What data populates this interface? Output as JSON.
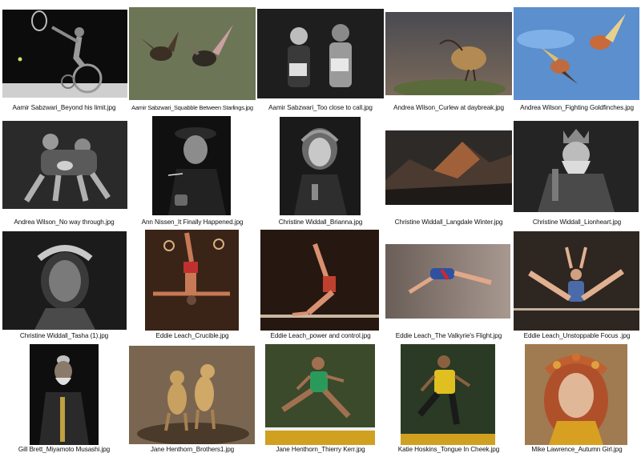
{
  "gallery": {
    "items": [
      {
        "filename": "Aamir Sabzwari_Beyond his limit.jpg",
        "subject": "wheelchair-tennis-icon",
        "bg": "#0c0c0c",
        "fg": "#9a9a9a"
      },
      {
        "filename": "Aamir Sabzwari_Squabble Between Starlings.jpg",
        "subject": "starlings-icon",
        "bg": "#6d7557",
        "fg": "#3a2f22"
      },
      {
        "filename": "Aamir Sabzwari_Too close to call.jpg",
        "subject": "runners-icon",
        "bg": "#1e1e1e",
        "fg": "#c9c9c9"
      },
      {
        "filename": "Andrea Wilson_Curlew at daybreak.jpg",
        "subject": "curlew-icon",
        "bg": "#5d5148",
        "fg": "#b38a52"
      },
      {
        "filename": "Andrea Wilson_Fighting Goldfinches.jpg",
        "subject": "goldfinches-icon",
        "bg": "#5b8fce",
        "fg": "#c86a3a"
      },
      {
        "filename": "Andrea Wilson_No way through.jpg",
        "subject": "rugby-icon",
        "bg": "#2a2a2a",
        "fg": "#a8a8a8"
      },
      {
        "filename": "Ann Nissen_It Finally Happened.jpg",
        "subject": "smoker-portrait-icon",
        "bg": "#101010",
        "fg": "#8c8c8c"
      },
      {
        "filename": "Christine Widdall_Brianna.jpg",
        "subject": "girl-portrait-icon",
        "bg": "#1a1a1a",
        "fg": "#bdbdbd"
      },
      {
        "filename": "Christine Widdall_Langdale Winter.jpg",
        "subject": "mountains-icon",
        "bg": "#3a3530",
        "fg": "#a0603a"
      },
      {
        "filename": "Christine Widdall_Lionheart.jpg",
        "subject": "king-portrait-icon",
        "bg": "#242424",
        "fg": "#bcbcbc"
      },
      {
        "filename": "Christine Widdall_Tasha (1).jpg",
        "subject": "woman-portrait-icon",
        "bg": "#1b1b1b",
        "fg": "#9c9c9c"
      },
      {
        "filename": "Eddie Leach_Crucible.jpg",
        "subject": "rings-gymnast-icon",
        "bg": "#3a2418",
        "fg": "#c77a55"
      },
      {
        "filename": "Eddie Leach_power and control.jpg",
        "subject": "bar-gymnast-icon",
        "bg": "#261810",
        "fg": "#c04030"
      },
      {
        "filename": "Eddie Leach_The Valkyrie's Flight.jpg",
        "subject": "diving-gymnast-icon",
        "bg": "#8a7a70",
        "fg": "#3050a0"
      },
      {
        "filename": "Eddie Leach_Unstoppable Focus .jpg",
        "subject": "split-gymnast-icon",
        "bg": "#2e2620",
        "fg": "#4a6aa8"
      },
      {
        "filename": "Gill Brett_Miyamoto Musashi.jpg",
        "subject": "samurai-portrait-icon",
        "bg": "#0e0e0e",
        "fg": "#6a5a4a"
      },
      {
        "filename": "Jane Henthorn_Brothers1.jpg",
        "subject": "cheetahs-icon",
        "bg": "#7a6650",
        "fg": "#c8a060"
      },
      {
        "filename": "Jane Henthorn_Thierry Kerr.jpg",
        "subject": "hurdler-icon",
        "bg": "#3a4a2a",
        "fg": "#d0a020"
      },
      {
        "filename": "Katie Hoskins_Tongue In Cheek.jpg",
        "subject": "hurdler-yellow-icon",
        "bg": "#2a3a24",
        "fg": "#e0c020"
      },
      {
        "filename": "Mike Lawrence_Autumn Girl.jpg",
        "subject": "autumn-girl-icon",
        "bg": "#a07a50",
        "fg": "#c06030"
      }
    ]
  },
  "colors": {
    "page_bg": "#ffffff",
    "caption_text": "#111111"
  }
}
